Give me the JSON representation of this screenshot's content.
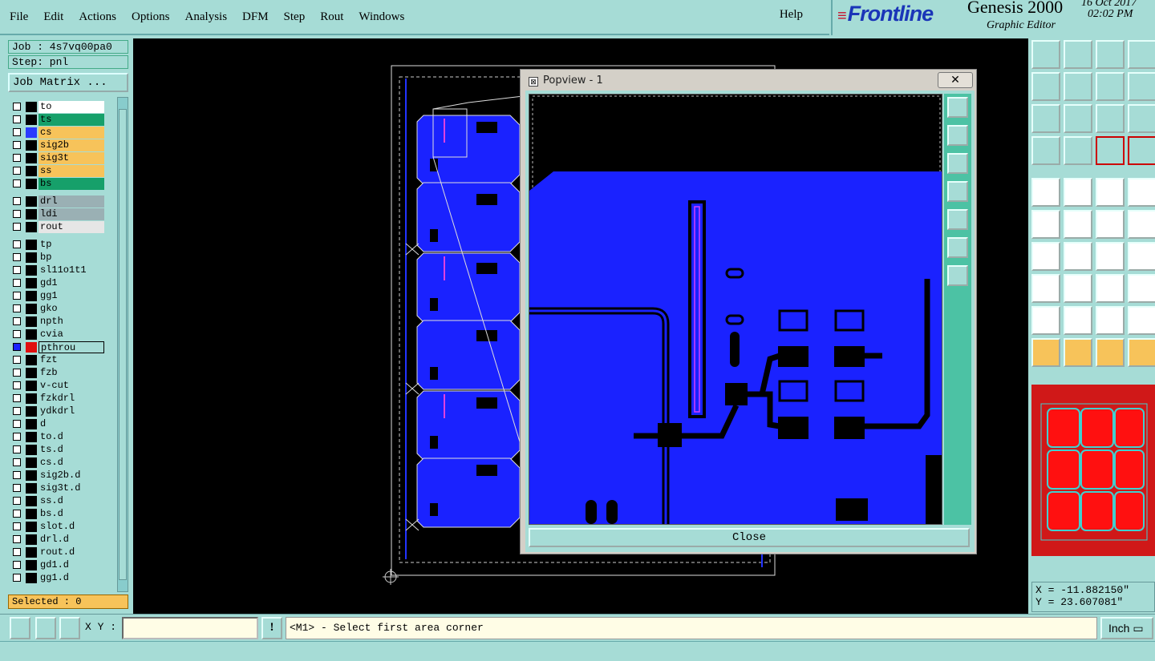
{
  "menu": {
    "items": [
      "File",
      "Edit",
      "Actions",
      "Options",
      "Analysis",
      "DFM",
      "Step",
      "Rout",
      "Windows"
    ],
    "help": "Help"
  },
  "brand": {
    "logo": "Frontline",
    "product": "Genesis 2000",
    "subtitle": "Graphic Editor",
    "date": "16 Oct 2017",
    "time": "02:02 PM"
  },
  "job": {
    "job_label": "Job : 4s7vq00pa0",
    "step_label": "Step: pnl",
    "matrix_button": "Job Matrix ...",
    "selected": "Selected : 0"
  },
  "layers": [
    {
      "name": "to",
      "bg": "#ffffff",
      "clr": "#000000"
    },
    {
      "name": "ts",
      "bg": "#16a06a",
      "clr": "#000000"
    },
    {
      "name": "cs",
      "bg": "#f7c35a",
      "clr": "#2b3bff"
    },
    {
      "name": "sig2b",
      "bg": "#f7c35a",
      "clr": "#000000"
    },
    {
      "name": "sig3t",
      "bg": "#f7c35a",
      "clr": "#000000"
    },
    {
      "name": "ss",
      "bg": "#f7c35a",
      "clr": "#000000"
    },
    {
      "name": "bs",
      "bg": "#16a06a",
      "clr": "#000000"
    },
    {
      "name": "drl",
      "bg": "#9ab0b4",
      "clr": "#000000",
      "gap": true
    },
    {
      "name": "ldi",
      "bg": "#9ab0b4",
      "clr": "#000000"
    },
    {
      "name": "rout",
      "bg": "#e6e6e6",
      "clr": "#000000"
    },
    {
      "name": "tp",
      "bg": "#a6dcd6",
      "clr": "#000000",
      "gap": true
    },
    {
      "name": "bp",
      "bg": "#a6dcd6",
      "clr": "#000000"
    },
    {
      "name": "sl11o1t1",
      "bg": "#a6dcd6",
      "clr": "#000000"
    },
    {
      "name": "gd1",
      "bg": "#a6dcd6",
      "clr": "#000000"
    },
    {
      "name": "gg1",
      "bg": "#a6dcd6",
      "clr": "#000000"
    },
    {
      "name": "gko",
      "bg": "#a6dcd6",
      "clr": "#000000"
    },
    {
      "name": "npth",
      "bg": "#a6dcd6",
      "clr": "#000000"
    },
    {
      "name": "cvia",
      "bg": "#a6dcd6",
      "clr": "#000000"
    },
    {
      "name": "pthrou",
      "bg": "#a6dcd6",
      "clr": "#e01010",
      "active": true
    },
    {
      "name": "fzt",
      "bg": "#a6dcd6",
      "clr": "#000000"
    },
    {
      "name": "fzb",
      "bg": "#a6dcd6",
      "clr": "#000000"
    },
    {
      "name": "v-cut",
      "bg": "#a6dcd6",
      "clr": "#000000"
    },
    {
      "name": "fzkdrl",
      "bg": "#a6dcd6",
      "clr": "#000000"
    },
    {
      "name": "ydkdrl",
      "bg": "#a6dcd6",
      "clr": "#000000"
    },
    {
      "name": "d",
      "bg": "#a6dcd6",
      "clr": "#000000"
    },
    {
      "name": "to.d",
      "bg": "#a6dcd6",
      "clr": "#000000"
    },
    {
      "name": "ts.d",
      "bg": "#a6dcd6",
      "clr": "#000000"
    },
    {
      "name": "cs.d",
      "bg": "#a6dcd6",
      "clr": "#000000"
    },
    {
      "name": "sig2b.d",
      "bg": "#a6dcd6",
      "clr": "#000000"
    },
    {
      "name": "sig3t.d",
      "bg": "#a6dcd6",
      "clr": "#000000"
    },
    {
      "name": "ss.d",
      "bg": "#a6dcd6",
      "clr": "#000000"
    },
    {
      "name": "bs.d",
      "bg": "#a6dcd6",
      "clr": "#000000"
    },
    {
      "name": "slot.d",
      "bg": "#a6dcd6",
      "clr": "#000000"
    },
    {
      "name": "drl.d",
      "bg": "#a6dcd6",
      "clr": "#000000"
    },
    {
      "name": "rout.d",
      "bg": "#a6dcd6",
      "clr": "#000000"
    },
    {
      "name": "gd1.d",
      "bg": "#a6dcd6",
      "clr": "#000000"
    },
    {
      "name": "gg1.d",
      "bg": "#a6dcd6",
      "clr": "#000000"
    }
  ],
  "popview": {
    "title": "Popview - 1",
    "close_x": "✕",
    "close_button": "Close"
  },
  "coords": {
    "x": "X = -11.882150\"",
    "y": "Y = 23.607081\""
  },
  "bottom": {
    "xy_label": "X Y :",
    "xy_value": "",
    "warn": "!",
    "prompt": "<M1> - Select first area corner",
    "units": "Inch"
  },
  "colors": {
    "panel": "#a6dcd6",
    "copper": "#1a22ff",
    "highlight": "#f7c35a",
    "overview_red": "#d01818"
  },
  "icons": {
    "right_toolbar": [
      "open-job-icon",
      "save-icon",
      "home-icon",
      "split-view-icon",
      "zoom-left-icon",
      "zoom-right-icon",
      "undo-icon",
      "redo-icon",
      "zoom-fit-icon",
      "zoom-home-icon",
      "scale-1-2-icon",
      "help-icon",
      "settings-icon",
      "grid-icon",
      "net-icon",
      "layers-icon",
      "snap-icon",
      "highlight-icon",
      "measure-icon",
      "pad-icon",
      "connect-icon",
      "cross-icon",
      "move-icon",
      "draw-icon",
      "line-icon",
      "arc-icon",
      "undo-arc-icon",
      "text-icon",
      "add-pad-icon",
      "minus-icon",
      "center-icon",
      "copy-icon",
      "triangle-icon",
      "outline-icon",
      "fill-icon",
      "route-icon",
      "pointer-icon",
      "select-icon",
      "select-arc-icon",
      "net-select-icon"
    ]
  }
}
